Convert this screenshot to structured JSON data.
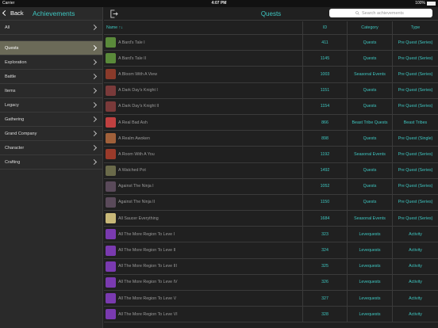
{
  "status": {
    "carrier": "Carrier",
    "time": "4:07 PM",
    "battery": "100%"
  },
  "sidebar": {
    "back_label": "Back",
    "title": "Achievements",
    "all_label": "All",
    "items": [
      {
        "label": "Quests",
        "selected": true
      },
      {
        "label": "Exploration",
        "selected": false
      },
      {
        "label": "Battle",
        "selected": false
      },
      {
        "label": "Items",
        "selected": false
      },
      {
        "label": "Legacy",
        "selected": false
      },
      {
        "label": "Gathering",
        "selected": false
      },
      {
        "label": "Grand Company",
        "selected": false
      },
      {
        "label": "Character",
        "selected": false
      },
      {
        "label": "Crafting",
        "selected": false
      }
    ]
  },
  "main": {
    "title": "Quests",
    "search_placeholder": "Search achievements",
    "columns": {
      "name": "Name ↑↓",
      "id": "ID",
      "category": "Category",
      "type": "Type"
    },
    "rows": [
      {
        "name": "A Bard's Tale I",
        "id": "411",
        "category": "Quests",
        "type": "Pre Quest (Series)",
        "icon": "green-bard-icon",
        "icon_color": "#5a8a3a"
      },
      {
        "name": "A Bard's Tale II",
        "id": "1145",
        "category": "Quests",
        "type": "Pre Quest (Series)",
        "icon": "green-bard-icon",
        "icon_color": "#5a8a3a"
      },
      {
        "name": "A Bloom With A View",
        "id": "1003",
        "category": "Seasonal Events",
        "type": "Pre Quest (Series)",
        "icon": "red-flower-icon",
        "icon_color": "#8a3a2a"
      },
      {
        "name": "A Dark Day's Knight I",
        "id": "1151",
        "category": "Quests",
        "type": "Pre Quest (Series)",
        "icon": "dark-knight-icon",
        "icon_color": "#7a3a3a"
      },
      {
        "name": "A Dark Day's Knight II",
        "id": "1154",
        "category": "Quests",
        "type": "Pre Quest (Series)",
        "icon": "dark-knight-icon",
        "icon_color": "#7a3a3a"
      },
      {
        "name": "A Real Bad Ash",
        "id": "866",
        "category": "Beast Tribe Quests",
        "type": "Beast Tribes",
        "icon": "red-bird-icon",
        "icon_color": "#c04040"
      },
      {
        "name": "A Realm Awoken",
        "id": "898",
        "category": "Quests",
        "type": "Pre Quest (Single)",
        "icon": "book-icon",
        "icon_color": "#a0603a"
      },
      {
        "name": "A Room With A You",
        "id": "1192",
        "category": "Seasonal Events",
        "type": "Pre Quest (Series)",
        "icon": "red-flower-icon",
        "icon_color": "#9a3a2a"
      },
      {
        "name": "A Watched Pot",
        "id": "1492",
        "category": "Quests",
        "type": "Pre Quest (Series)",
        "icon": "pot-icon",
        "icon_color": "#6a6a4a"
      },
      {
        "name": "Against The Ninja I",
        "id": "1052",
        "category": "Quests",
        "type": "Pre Quest (Series)",
        "icon": "ninja-icon",
        "icon_color": "#5a4a5a"
      },
      {
        "name": "Against The Ninja II",
        "id": "1150",
        "category": "Quests",
        "type": "Pre Quest (Series)",
        "icon": "ninja-icon",
        "icon_color": "#5a4a5a"
      },
      {
        "name": "All Saucer Everything",
        "id": "1684",
        "category": "Seasonal Events",
        "type": "Pre Quest (Series)",
        "icon": "saucer-icon",
        "icon_color": "#c8b878"
      },
      {
        "name": "All The More Region To Leve I",
        "id": "323",
        "category": "Levequests",
        "type": "Activity",
        "icon": "purple-runner-icon",
        "icon_color": "#7a3ab0"
      },
      {
        "name": "All The More Region To Leve II",
        "id": "324",
        "category": "Levequests",
        "type": "Activity",
        "icon": "purple-runner-icon",
        "icon_color": "#7a3ab0"
      },
      {
        "name": "All The More Region To Leve III",
        "id": "325",
        "category": "Levequests",
        "type": "Activity",
        "icon": "purple-runner-icon",
        "icon_color": "#7a3ab0"
      },
      {
        "name": "All The More Region To Leve IV",
        "id": "326",
        "category": "Levequests",
        "type": "Activity",
        "icon": "purple-runner-icon",
        "icon_color": "#7a3ab0"
      },
      {
        "name": "All The More Region To Leve V",
        "id": "327",
        "category": "Levequests",
        "type": "Activity",
        "icon": "purple-runner-icon",
        "icon_color": "#7a3ab0"
      },
      {
        "name": "All The More Region To Leve VI",
        "id": "328",
        "category": "Levequests",
        "type": "Activity",
        "icon": "purple-runner-icon",
        "icon_color": "#7a3ab0"
      }
    ]
  }
}
